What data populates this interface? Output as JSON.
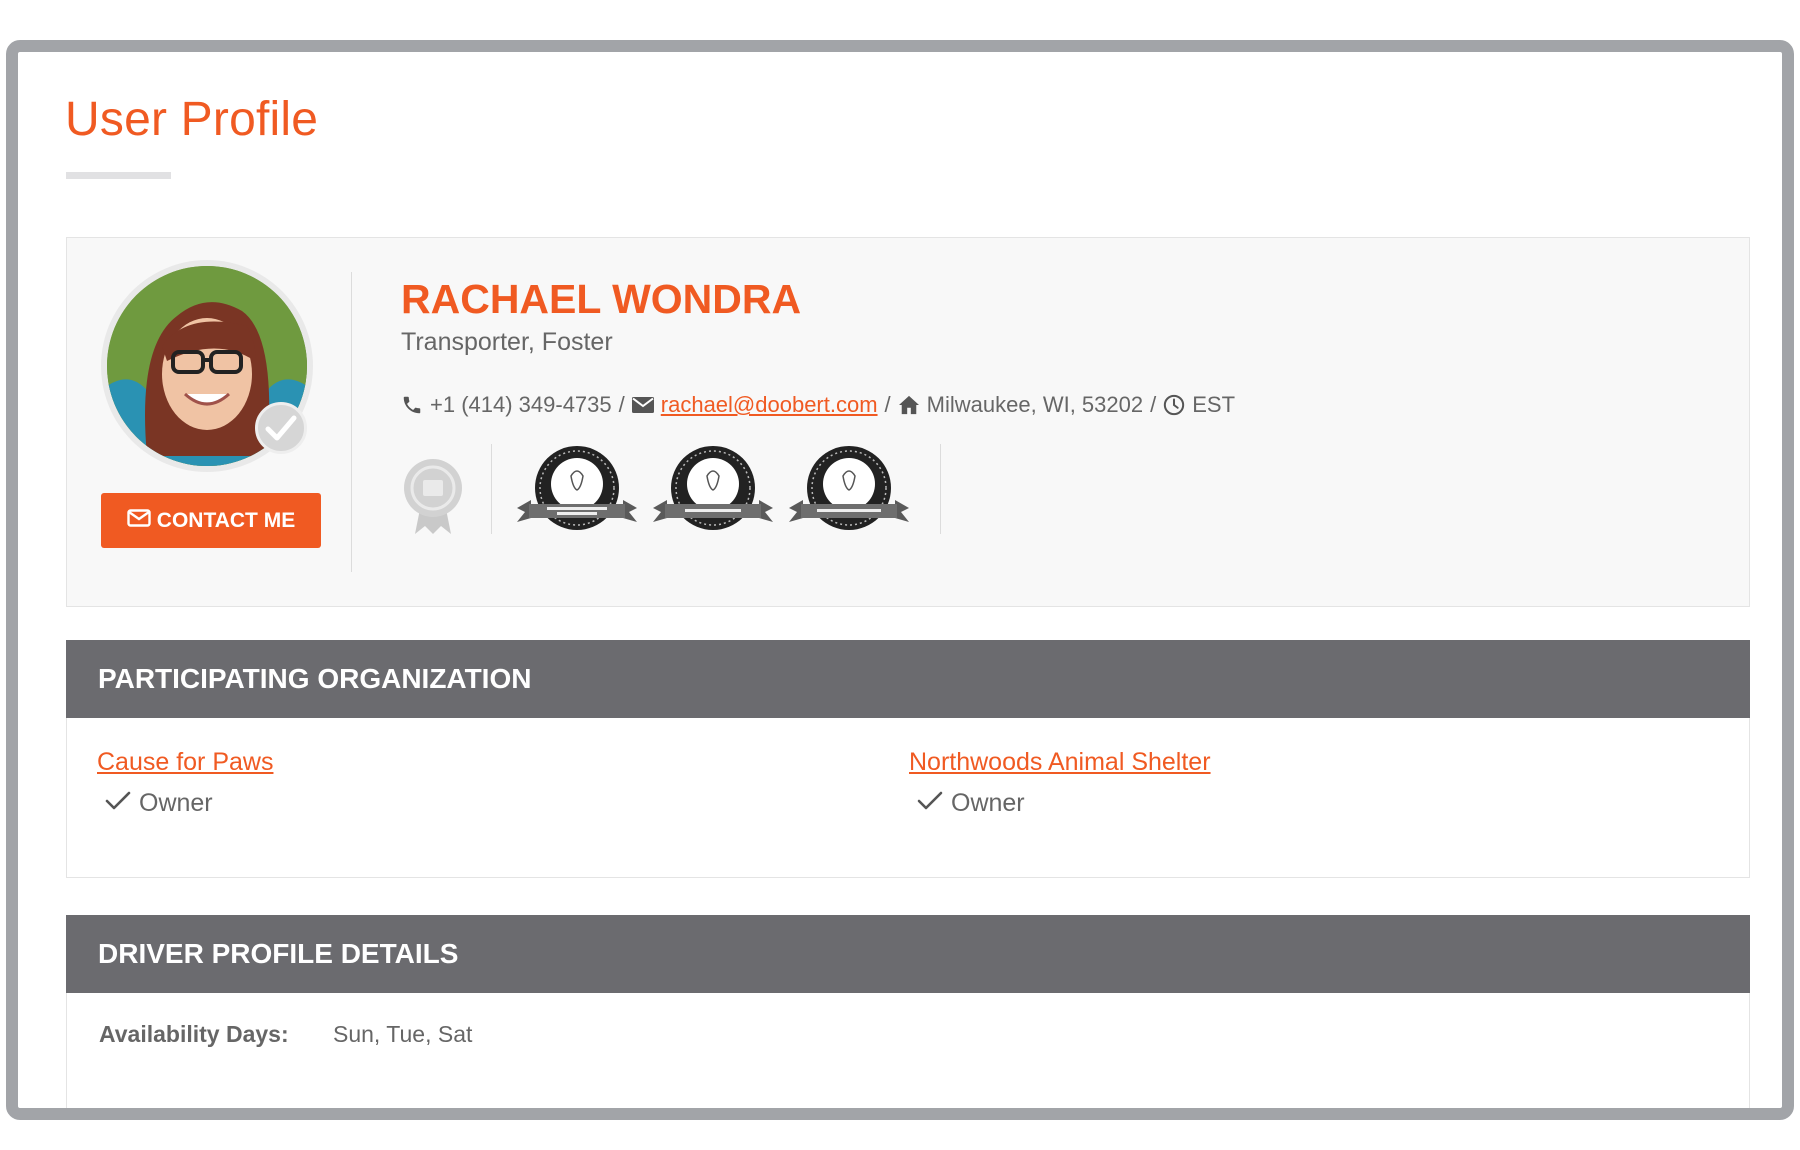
{
  "page": {
    "title": "User Profile"
  },
  "profile": {
    "name": "RACHAEL WONDRA",
    "roles": "Transporter, Foster",
    "contact_button": "CONTACT ME",
    "phone": "+1 (414) 349-4735",
    "email": "rachael@doobert.com",
    "location": "Milwaukee, WI, 53202",
    "timezone": "EST",
    "separator": "/",
    "badges": [
      {
        "icon": "certified-animal-rescue-transporter-badge"
      },
      {
        "icon": "certified-foster-home-badge"
      },
      {
        "icon": "certified-tnr-professional-badge"
      }
    ]
  },
  "organizations": {
    "header": "PARTICIPATING ORGANIZATION",
    "items": [
      {
        "name": "Cause for Paws",
        "role": "Owner"
      },
      {
        "name": "Northwoods Animal Shelter",
        "role": "Owner"
      }
    ]
  },
  "driver": {
    "header": "DRIVER PROFILE DETAILS",
    "availability_label": "Availability Days:",
    "availability_value": "Sun, Tue, Sat"
  },
  "colors": {
    "accent": "#f05a22",
    "header_bg": "#6b6b6f",
    "frame": "#a2a4a8"
  }
}
